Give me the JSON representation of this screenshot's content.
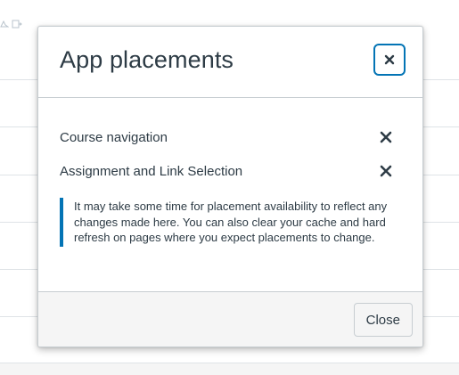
{
  "modal": {
    "title": "App placements",
    "placements": [
      {
        "label": "Course navigation"
      },
      {
        "label": "Assignment and Link Selection"
      }
    ],
    "alert_text": "It may take some time for placement availability to reflect any changes made here. You can also clear your cache and hard refresh on pages where you expect placements to change.",
    "close_button_label": "Close"
  },
  "colors": {
    "accent": "#0374b5",
    "text": "#2d3b45",
    "footer_bg": "#f5f5f5",
    "border": "#c7cdd1"
  },
  "icons": {
    "header_close": "close-icon",
    "remove": "remove-icon"
  }
}
